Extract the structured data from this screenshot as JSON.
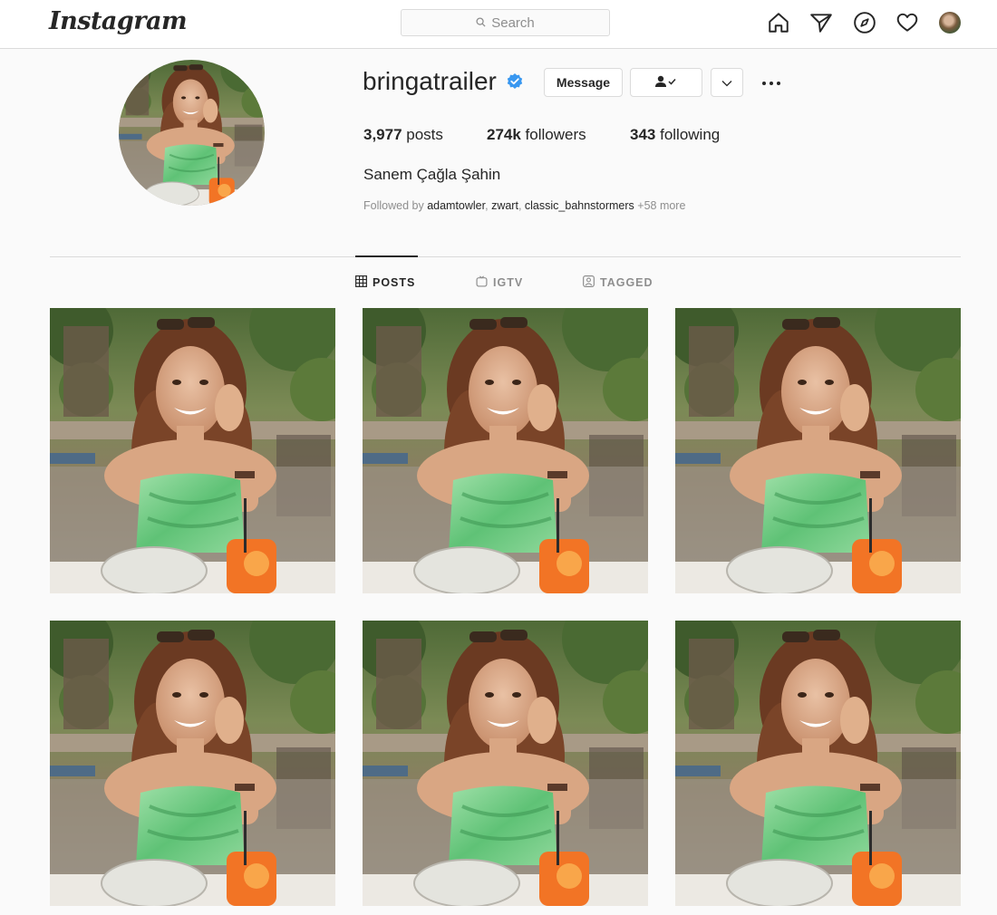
{
  "app": {
    "logo": "Instagram"
  },
  "nav": {
    "search_placeholder": "Search",
    "icons": [
      "home-icon",
      "direct-icon",
      "explore-icon",
      "activity-heart-icon",
      "profile-avatar"
    ]
  },
  "profile": {
    "username": "bringatrailer",
    "verified": true,
    "buttons": {
      "message": "Message",
      "following_icon": "person-check-icon",
      "more_dropdown_icon": "chevron-down-icon",
      "options_icon": "more-horizontal-icon"
    },
    "stats": {
      "posts_count": "3,977",
      "posts_label": " posts",
      "followers_count": "274k",
      "followers_label": " followers",
      "following_count": "343",
      "following_label": " following"
    },
    "full_name": "Sanem Çağla Şahin",
    "followed_by": {
      "prefix": "Followed by ",
      "accounts": [
        "adamtowler",
        "zwart",
        "classic_bahnstormers"
      ],
      "sep": ", ",
      "more": " +58 more"
    }
  },
  "tabs": [
    {
      "label": "POSTS",
      "icon": "grid-icon",
      "active": true
    },
    {
      "label": "IGTV",
      "icon": "igtv-icon",
      "active": false
    },
    {
      "label": "TAGGED",
      "icon": "tagged-icon",
      "active": false
    }
  ],
  "posts": [
    {
      "image": "woman-green-top-cafe-photo"
    },
    {
      "image": "woman-green-top-cafe-photo"
    },
    {
      "image": "woman-green-top-cafe-photo"
    },
    {
      "image": "woman-green-top-cafe-photo"
    },
    {
      "image": "woman-green-top-cafe-photo"
    },
    {
      "image": "woman-green-top-cafe-photo"
    }
  ],
  "colors": {
    "background": "#fafafa",
    "border": "#dbdbdb",
    "text": "#262626",
    "muted": "#8e8e8e",
    "verified": "#3897f0"
  }
}
